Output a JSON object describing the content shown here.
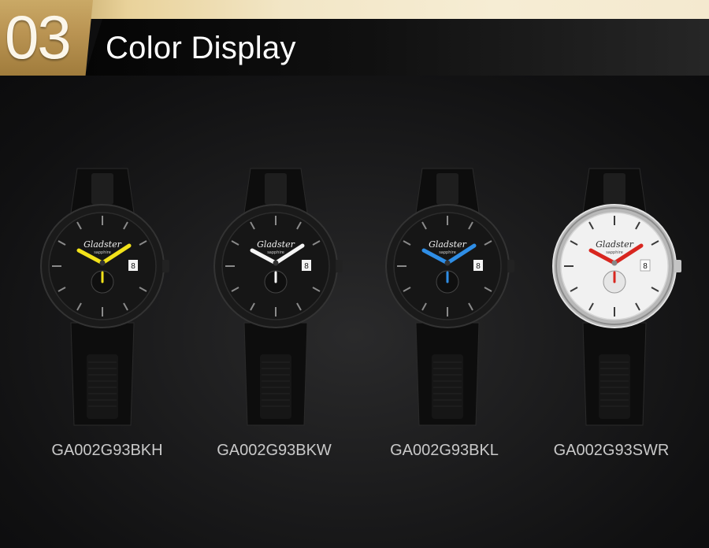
{
  "header": {
    "number": "03",
    "title": "Color Display"
  },
  "brand": {
    "logo": "Gladster",
    "subtitle": "sapphire"
  },
  "products": [
    {
      "model": "GA002G93BKH",
      "date": "8",
      "dial_color": "#161616",
      "hand_color": "#f2e21a",
      "case_color": "#1a1a1a"
    },
    {
      "model": "GA002G93BKW",
      "date": "8",
      "dial_color": "#161616",
      "hand_color": "#f5f5f5",
      "case_color": "#1a1a1a"
    },
    {
      "model": "GA002G93BKL",
      "date": "8",
      "dial_color": "#161616",
      "hand_color": "#2f8ee6",
      "case_color": "#1a1a1a"
    },
    {
      "model": "GA002G93SWR",
      "date": "8",
      "dial_color": "#f1f1f1",
      "hand_color": "#d8261f",
      "case_color": "#b8b8b8"
    }
  ]
}
